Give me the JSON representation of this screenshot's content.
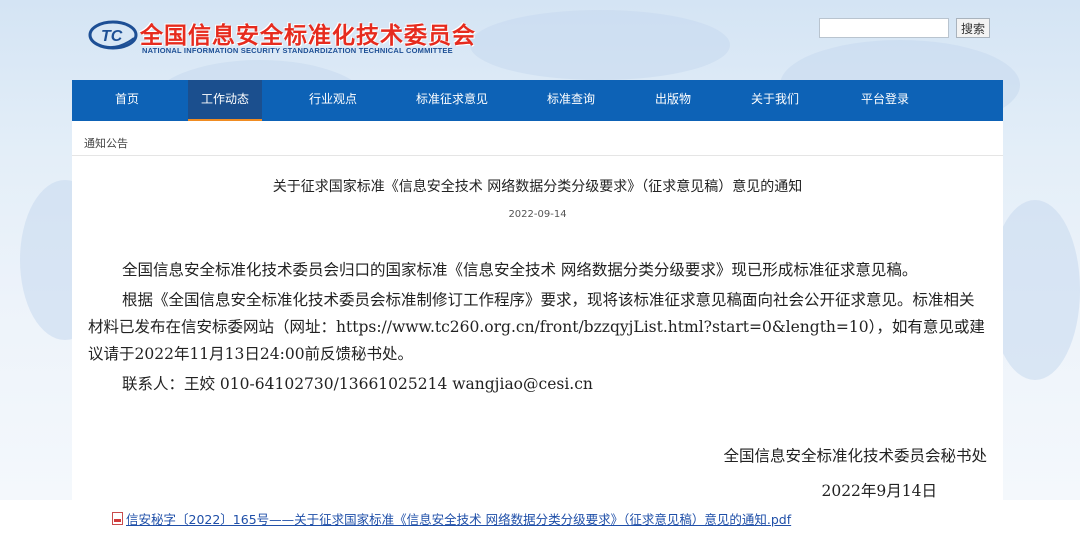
{
  "header": {
    "logo_abbr": "TC",
    "title": "全国信息安全标准化技术委员会",
    "subtitle": "NATIONAL INFORMATION SECURITY STANDARDIZATION TECHNICAL COMMITTEE",
    "search_placeholder": "",
    "search_button": "搜索"
  },
  "nav": {
    "items": [
      {
        "label": "首页"
      },
      {
        "label": "工作动态"
      },
      {
        "label": "行业观点"
      },
      {
        "label": "标准征求意见"
      },
      {
        "label": "标准查询"
      },
      {
        "label": "出版物"
      },
      {
        "label": "关于我们"
      },
      {
        "label": "平台登录"
      }
    ],
    "active_index": 1
  },
  "breadcrumb": "通知公告",
  "article": {
    "title": "关于征求国家标准《信息安全技术 网络数据分类分级要求》（征求意见稿）意见的通知",
    "date": "2022-09-14",
    "paragraph1": "全国信息安全标准化技术委员会归口的国家标准《信息安全技术 网络数据分类分级要求》现已形成标准征求意见稿。",
    "paragraph2": "根据《全国信息安全标准化技术委员会标准制修订工作程序》要求，现将该标准征求意见稿面向社会公开征求意见。标准相关材料已发布在信安标委网站（网址：https://www.tc260.org.cn/front/bzzqyjList.html?start=0&length=10），如有意见或建议请于2022年11月13日24:00前反馈秘书处。",
    "contact": "联系人：王姣  010-64102730/13661025214  wangjiao@cesi.cn",
    "signature": "全国信息安全标准化技术委员会秘书处",
    "sign_date": "2022年9月14日"
  },
  "attachment": {
    "icon": "pdf-icon",
    "label": "信安秘字〔2022〕165号——关于征求国家标准《信息安全技术 网络数据分类分级要求》（征求意见稿）意见的通知.pdf"
  },
  "colors": {
    "nav_bg": "#0d62b6",
    "nav_active": "#1b4f8e",
    "accent_underline": "#f08c22",
    "title_red": "#e62b1e",
    "link_blue": "#1f4fa8"
  }
}
